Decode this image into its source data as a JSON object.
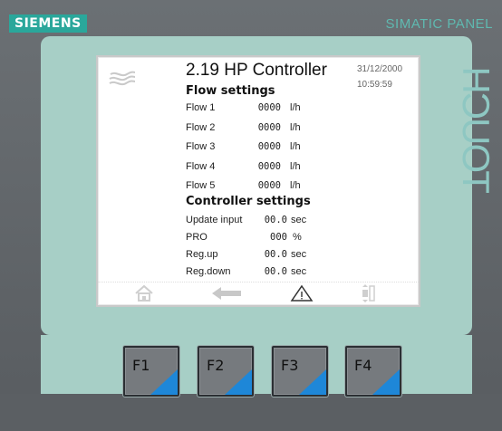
{
  "brand": "SIEMENS",
  "panel_model": "SIMATIC PANEL",
  "panel_type": "TOUCH",
  "screen": {
    "title": "2.19 HP Controller",
    "date": "31/12/2000",
    "time": "10:59:59"
  },
  "flow_settings": {
    "heading": "Flow settings",
    "rows": [
      {
        "label": "Flow 1",
        "value": "0000",
        "unit": "l/h"
      },
      {
        "label": "Flow 2",
        "value": "0000",
        "unit": "l/h"
      },
      {
        "label": "Flow 3",
        "value": "0000",
        "unit": "l/h"
      },
      {
        "label": "Flow 4",
        "value": "0000",
        "unit": "l/h"
      },
      {
        "label": "Flow 5",
        "value": "0000",
        "unit": "l/h"
      }
    ]
  },
  "controller_settings": {
    "heading": "Controller settings",
    "rows": [
      {
        "label": "Update input",
        "value": "00.0",
        "unit": "sec"
      },
      {
        "label": "PRO",
        "value": "000",
        "unit": "%"
      },
      {
        "label": "Reg.up",
        "value": "00.0",
        "unit": "sec"
      },
      {
        "label": "Reg.down",
        "value": "00.0",
        "unit": "sec"
      }
    ]
  },
  "nav": {
    "icons": [
      "home-icon",
      "back-arrow-icon",
      "alarm-warning-icon",
      "scroll-icon"
    ]
  },
  "function_keys": [
    "F1",
    "F2",
    "F3",
    "F4"
  ],
  "colors": {
    "brand_teal": "#2aa79b",
    "frame": "#a7cfc6",
    "key_accent": "#1e87d8"
  }
}
